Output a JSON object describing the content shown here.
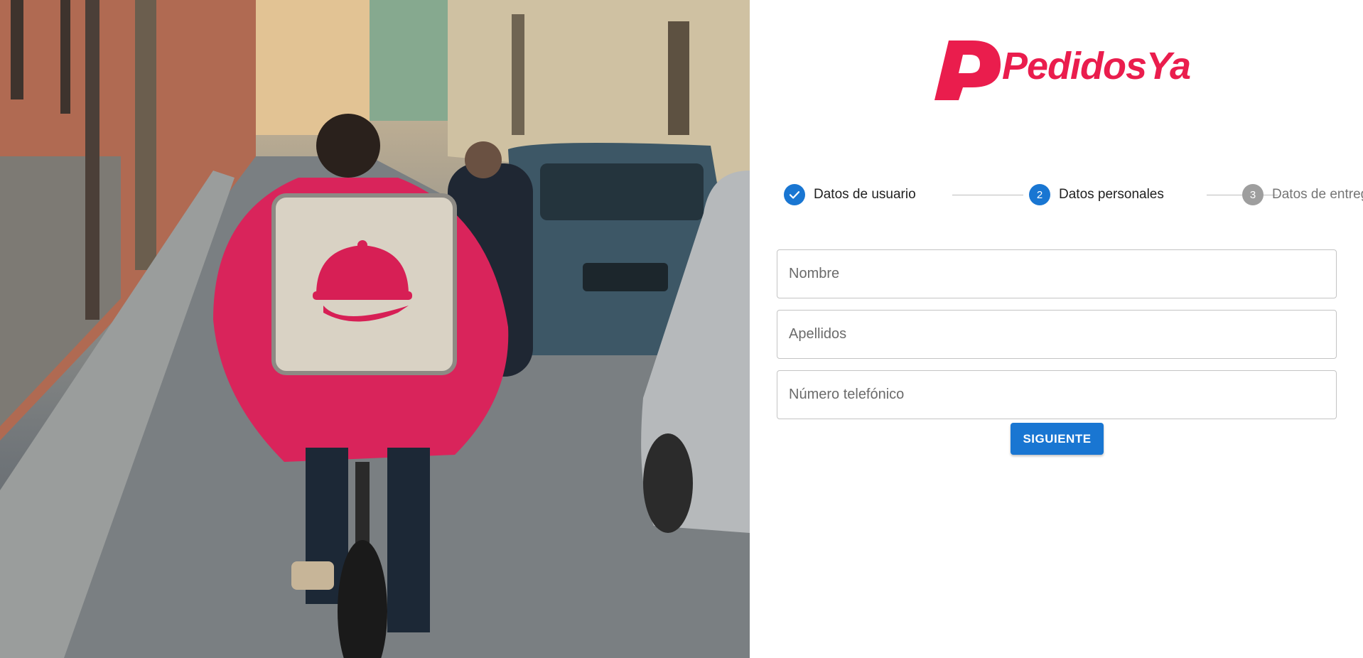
{
  "brand": {
    "name": "PedidosYa",
    "color": "#ea1d4d",
    "logo_icon": "pedidosya-p-logo-icon"
  },
  "hero": {
    "description_icon": "delivery-rider-photo"
  },
  "stepper": {
    "steps": [
      {
        "number": "1",
        "label": "Datos de usuario",
        "state": "completed",
        "icon": "check-icon"
      },
      {
        "number": "2",
        "label": "Datos personales",
        "state": "active"
      },
      {
        "number": "3",
        "label": "Datos de entrega",
        "state": "pending"
      }
    ]
  },
  "form": {
    "first_name": {
      "placeholder": "Nombre",
      "value": ""
    },
    "last_name": {
      "placeholder": "Apellidos",
      "value": ""
    },
    "phone": {
      "placeholder": "Número telefónico",
      "value": ""
    },
    "next_label": "SIGUIENTE"
  },
  "colors": {
    "primary": "#1976d2",
    "pending": "#9e9e9e",
    "brand": "#ea1d4d"
  }
}
